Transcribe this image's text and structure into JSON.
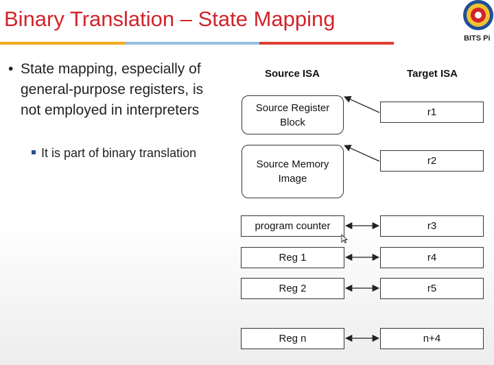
{
  "slide": {
    "title": "Binary Translation – State Mapping",
    "logo_text": "BITS Pi"
  },
  "bullets": {
    "main": "State mapping, especially of general-purpose registers, is not employed in interpreters",
    "sub": "It is part of binary translation"
  },
  "diagram": {
    "source_header": "Source ISA",
    "target_header": "Target ISA",
    "source_register_block": "Source Register Block",
    "source_memory_image": "Source Memory Image",
    "program_counter": "program counter",
    "reg1": "Reg 1",
    "reg2": "Reg 2",
    "regn": "Reg n",
    "targets": [
      "r1",
      "r2",
      "r3",
      "r4",
      "r5",
      "n+4"
    ]
  },
  "colors": {
    "title": "#d2232a",
    "rule_orange": "#f3a81c",
    "rule_blue": "#8fbde3",
    "rule_red": "#e03a2f"
  }
}
